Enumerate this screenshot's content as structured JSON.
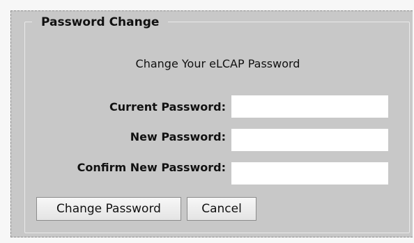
{
  "password_change": {
    "legend": "Password Change",
    "subtitle": "Change Your eLCAP Password",
    "fields": [
      {
        "label": "Current Password:",
        "value": "",
        "placeholder": ""
      },
      {
        "label": "New Password:",
        "value": "",
        "placeholder": ""
      },
      {
        "label": "Confirm New Password:",
        "value": "",
        "placeholder": ""
      }
    ],
    "buttons": {
      "change": "Change Password",
      "cancel": "Cancel"
    }
  }
}
